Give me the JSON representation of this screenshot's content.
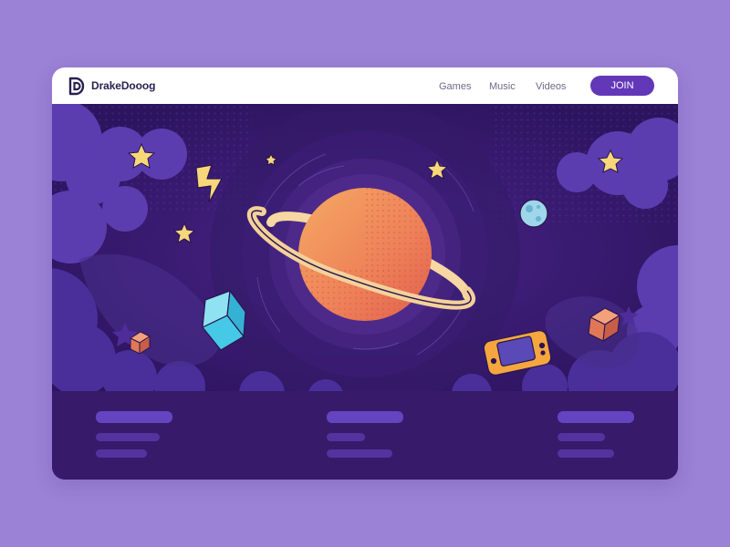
{
  "page": {
    "background": "#9b82d6"
  },
  "header": {
    "brand": "DrakeDooog",
    "nav": [
      {
        "label": "Games"
      },
      {
        "label": "Music"
      },
      {
        "label": "Videos"
      }
    ],
    "join_label": "JOIN",
    "accent_color": "#6238b8"
  },
  "hero": {
    "icons": [
      "planet-icon",
      "star-icon",
      "lightning-icon",
      "cube-icon",
      "moon-icon",
      "game-console-icon",
      "cloud-icon"
    ]
  },
  "footer": {
    "columns": [
      {
        "name": "column-1"
      },
      {
        "name": "column-2"
      },
      {
        "name": "column-3"
      }
    ]
  }
}
